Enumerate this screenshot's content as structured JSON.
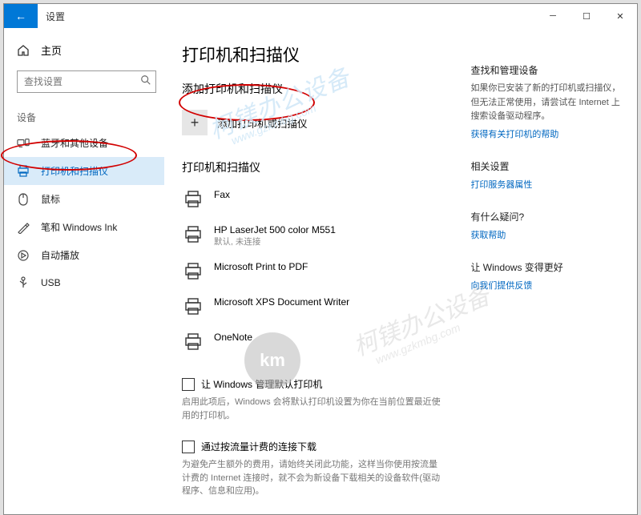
{
  "titlebar": {
    "title": "设置",
    "back": "←"
  },
  "sidebar": {
    "home": "主页",
    "search_placeholder": "查找设置",
    "section": "设备",
    "items": [
      {
        "icon": "bt",
        "label": "蓝牙和其他设备"
      },
      {
        "icon": "printer",
        "label": "打印机和扫描仪"
      },
      {
        "icon": "mouse",
        "label": "鼠标"
      },
      {
        "icon": "pen",
        "label": "笔和 Windows Ink"
      },
      {
        "icon": "autoplay",
        "label": "自动播放"
      },
      {
        "icon": "usb",
        "label": "USB"
      }
    ]
  },
  "main": {
    "page_title": "打印机和扫描仪",
    "add_heading": "添加打印机和扫描仪",
    "add_label": "添加打印机或扫描仪",
    "list_heading": "打印机和扫描仪",
    "devices": [
      {
        "name": "Fax",
        "sub": ""
      },
      {
        "name": "HP LaserJet 500 color M551",
        "sub": "默认, 未连接"
      },
      {
        "name": "Microsoft Print to PDF",
        "sub": ""
      },
      {
        "name": "Microsoft XPS Document Writer",
        "sub": ""
      },
      {
        "name": "OneNote",
        "sub": ""
      }
    ],
    "opt1_label": "让 Windows 管理默认打印机",
    "opt1_desc": "启用此项后，Windows 会将默认打印机设置为你在当前位置最近使用的打印机。",
    "opt2_label": "通过按流量计费的连接下载",
    "opt2_desc": "为避免产生额外的费用，请始终关闭此功能，这样当你使用按流量计费的 Internet 连接时，就不会为新设备下载相关的设备软件(驱动程序、信息和应用)。"
  },
  "side": {
    "b1_h": "查找和管理设备",
    "b1_p": "如果你已安装了新的打印机或扫描仪，但无法正常使用，请尝试在 Internet 上搜索设备驱动程序。",
    "b1_link": "获得有关打印机的帮助",
    "b2_h": "相关设置",
    "b2_link": "打印服务器属性",
    "b3_h": "有什么疑问?",
    "b3_link": "获取帮助",
    "b4_h": "让 Windows 变得更好",
    "b4_link": "向我们提供反馈"
  },
  "watermark": {
    "text": "柯镁办公设备",
    "url": "www.gzkmbg.com",
    "logo": "km"
  }
}
